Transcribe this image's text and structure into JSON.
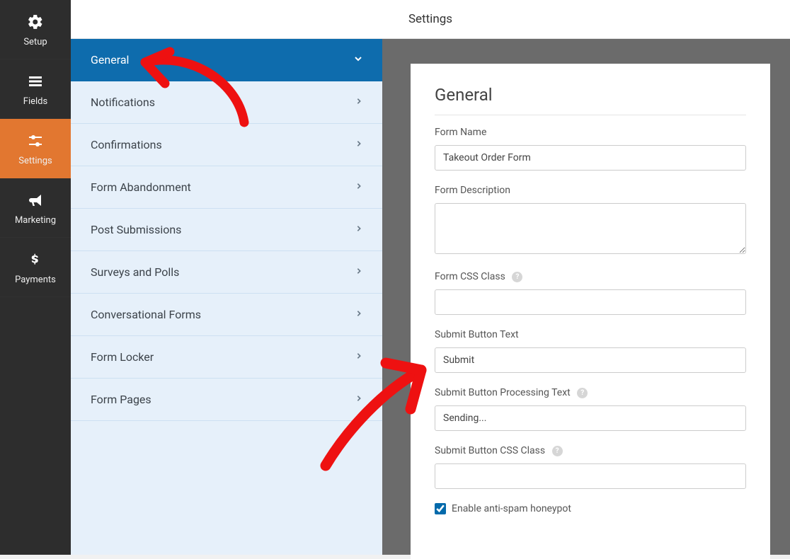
{
  "topbar": {
    "title": "Settings"
  },
  "nav": {
    "items": [
      {
        "label": "Setup"
      },
      {
        "label": "Fields"
      },
      {
        "label": "Settings"
      },
      {
        "label": "Marketing"
      },
      {
        "label": "Payments"
      }
    ]
  },
  "settings_tabs": [
    {
      "label": "General",
      "active": true
    },
    {
      "label": "Notifications"
    },
    {
      "label": "Confirmations"
    },
    {
      "label": "Form Abandonment"
    },
    {
      "label": "Post Submissions"
    },
    {
      "label": "Surveys and Polls"
    },
    {
      "label": "Conversational Forms"
    },
    {
      "label": "Form Locker"
    },
    {
      "label": "Form Pages"
    }
  ],
  "panel": {
    "heading": "General",
    "form_name_label": "Form Name",
    "form_name_value": "Takeout Order Form",
    "form_description_label": "Form Description",
    "form_description_value": "",
    "form_css_class_label": "Form CSS Class",
    "form_css_class_value": "",
    "submit_button_text_label": "Submit Button Text",
    "submit_button_text_value": "Submit",
    "submit_button_processing_label": "Submit Button Processing Text",
    "submit_button_processing_value": "Sending...",
    "submit_button_css_label": "Submit Button CSS Class",
    "submit_button_css_value": "",
    "honeypot_label": "Enable anti-spam honeypot",
    "honeypot_checked": true
  }
}
